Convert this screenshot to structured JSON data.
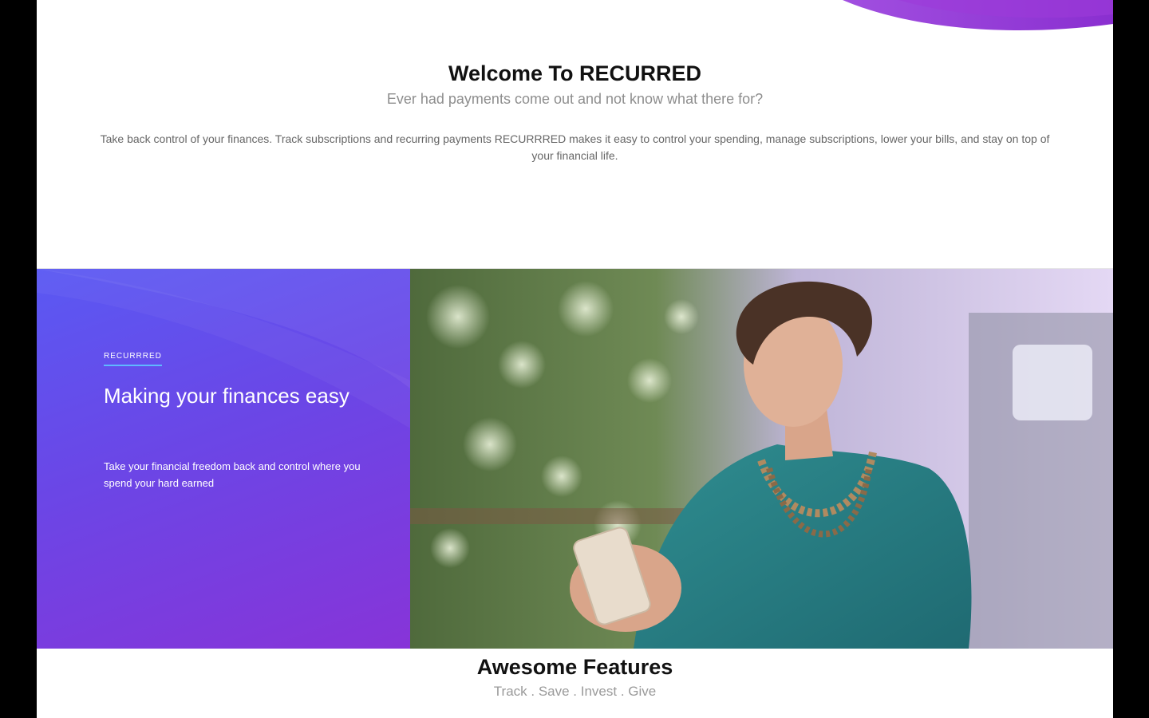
{
  "welcome": {
    "title": "Welcome To RECURRED",
    "subtitle": "Ever had payments come out and not know what there for?",
    "body": "Take back control of your finances. Track subscriptions and recurring payments RECURRRED makes it easy to control your spending, manage subscriptions, lower your bills, and stay on top of your financial life."
  },
  "hero": {
    "eyebrow": "RECURRRED",
    "title": "Making your finances easy",
    "text": "Take your financial freedom back and control where you spend your hard earned"
  },
  "features": {
    "title": "Awesome Features",
    "subtitle": "Track . Save . Invest . Give"
  },
  "colors": {
    "accent_purple": "#8a35d6",
    "gradient_start": "#5a59f3",
    "gradient_end": "#8734d8",
    "underline_blue": "#5fb8ff"
  }
}
